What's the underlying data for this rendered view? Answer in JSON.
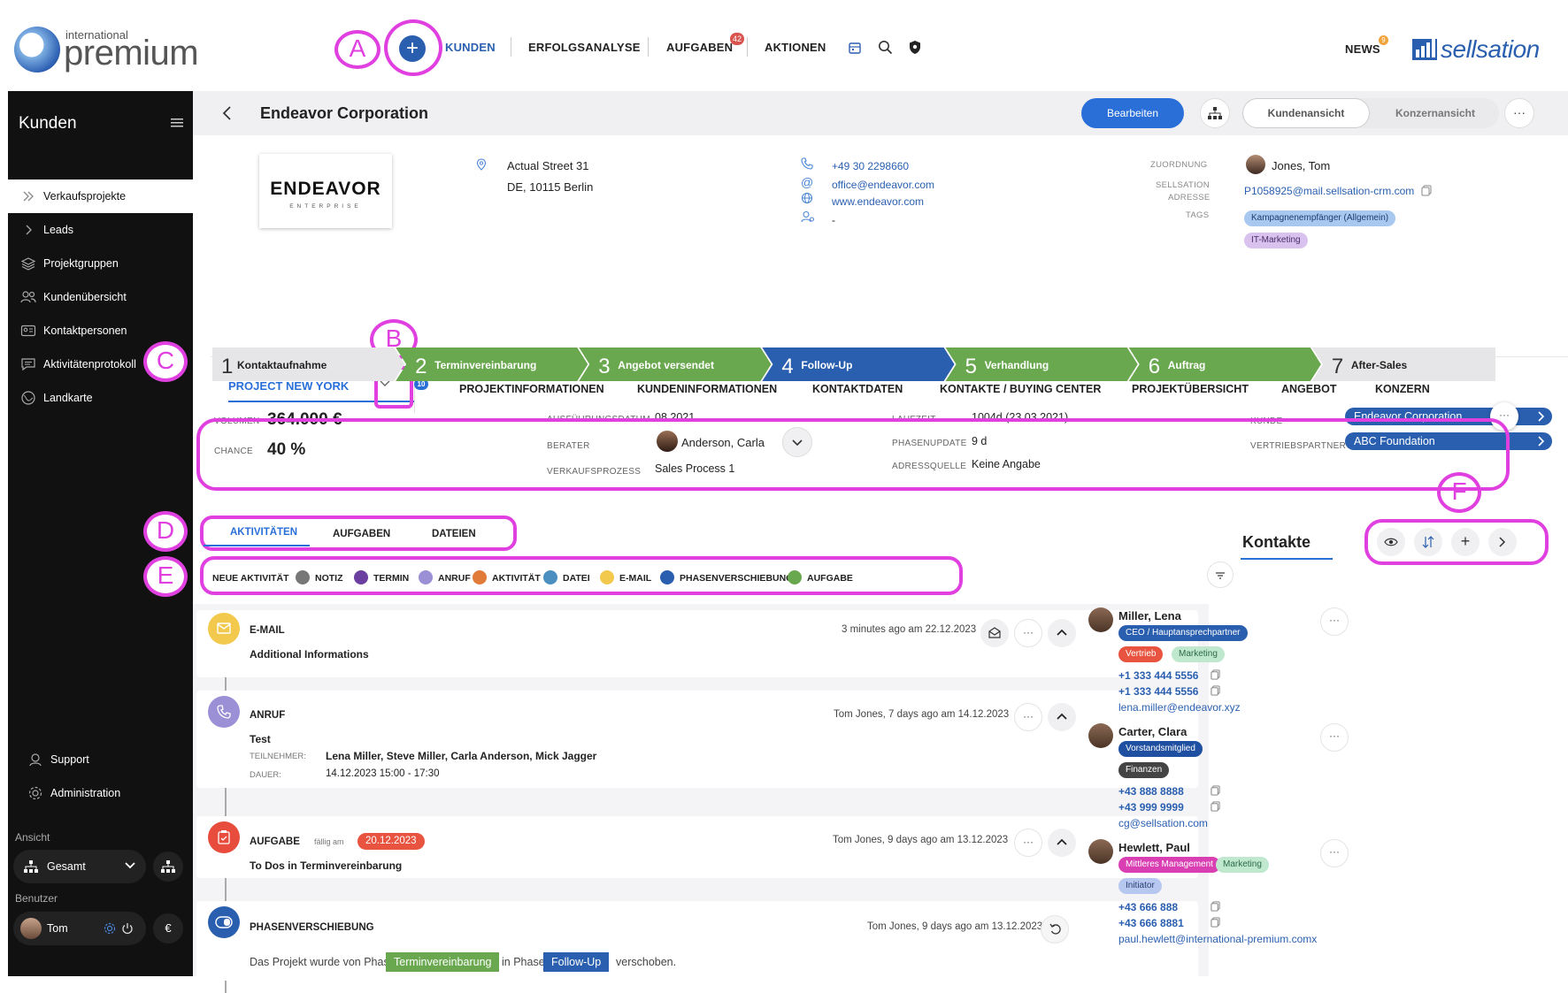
{
  "brand": {
    "small": "international",
    "big": "premium",
    "partner": "sellsation"
  },
  "nav": {
    "items": [
      "KUNDEN",
      "ERFOLGSANALYSE",
      "AUFGABEN",
      "AKTIONEN"
    ],
    "aufgaben_badge": "42",
    "news": "NEWS",
    "news_badge": "9"
  },
  "callouts": [
    "A",
    "B",
    "C",
    "D",
    "E",
    "F"
  ],
  "sidebar": {
    "title": "Kunden",
    "items": [
      "Verkaufsprojekte",
      "Leads",
      "Projektgruppen",
      "Kundenübersicht",
      "Kontaktpersonen",
      "Aktivitätenprotokoll",
      "Landkarte"
    ],
    "support": "Support",
    "admin": "Administration",
    "ansicht_label": "Ansicht",
    "ansicht_value": "Gesamt",
    "benutzer_label": "Benutzer",
    "user": "Tom",
    "currency": "€"
  },
  "header": {
    "title": "Endeavor Corporation",
    "edit": "Bearbeiten",
    "view1": "Kundenansicht",
    "view2": "Konzernansicht",
    "more": "···"
  },
  "company": {
    "logo_text": "ENDEAVOR",
    "logo_sub": "ENTERPRISE",
    "street": "Actual Street 31",
    "city": "DE, 10115 Berlin",
    "phone": "+49 30 2298660",
    "email": "office@endeavor.com",
    "web": "www.endeavor.com",
    "dash": "-",
    "zuordnung_label": "ZUORDNUNG",
    "zuordnung": "Jones, Tom",
    "sellsation_label1": "SELLSATION",
    "sellsation_label2": "ADRESSE",
    "sellsation_email": "P1058925@mail.sellsation-crm.com",
    "tags_label": "TAGS",
    "tags": [
      "Kampagnenempfänger (Allgemein)",
      "IT-Marketing"
    ]
  },
  "tabs": {
    "project": "PROJECT NEW YORK",
    "project_badge": "10",
    "items": [
      "PROJEKTINFORMATIONEN",
      "KUNDENINFORMATIONEN",
      "KONTAKTDATEN",
      "KONTAKTE / BUYING CENTER",
      "PROJEKTÜBERSICHT",
      "ANGEBOT",
      "KONZERN"
    ]
  },
  "stages": [
    {
      "n": "1",
      "name": "Kontaktaufnahme",
      "color": "#e6e6e8"
    },
    {
      "n": "2",
      "name": "Terminvereinbarung",
      "color": "#6aa84f"
    },
    {
      "n": "3",
      "name": "Angebot versendet",
      "color": "#6aa84f"
    },
    {
      "n": "4",
      "name": "Follow-Up",
      "color": "#2a5fb0"
    },
    {
      "n": "5",
      "name": "Verhandlung",
      "color": "#6aa84f"
    },
    {
      "n": "6",
      "name": "Auftrag",
      "color": "#6aa84f"
    },
    {
      "n": "7",
      "name": "After-Sales",
      "color": "#e6e6e8"
    }
  ],
  "info": {
    "volumen_label": "VOLUMEN",
    "volumen": "364.000 €",
    "chance_label": "CHANCE",
    "chance": "40 %",
    "ausf_label": "AUSFÜHRUNGSDATUM",
    "ausf": "08.2021",
    "berater_label": "BERATER",
    "berater": "Anderson, Carla",
    "vp_label": "VERKAUFSPROZESS",
    "vp": "Sales Process 1",
    "laufzeit_label": "LAUFZEIT",
    "laufzeit": "1004d (23.03.2021)",
    "phase_label": "PHASENUPDATE",
    "phase": "9 d",
    "quelle_label": "ADRESSQUELLE",
    "quelle": "Keine Angabe",
    "kunde_label": "KUNDE",
    "kunde": "Endeavor Corporation",
    "vp2_label": "VERTRIEBSPARTNER",
    "vp2": "ABC Foundation"
  },
  "subtabs": [
    "AKTIVITÄTEN",
    "AUFGABEN",
    "DATEIEN"
  ],
  "filters": [
    {
      "label": "NEUE AKTIVITÄT",
      "color": ""
    },
    {
      "label": "NOTIZ",
      "color": "#777"
    },
    {
      "label": "TERMIN",
      "color": "#6b3fa0"
    },
    {
      "label": "ANRUF",
      "color": "#9b8fd6"
    },
    {
      "label": "AKTIVITÄT",
      "color": "#e07b39"
    },
    {
      "label": "DATEI",
      "color": "#4a8fc0"
    },
    {
      "label": "E-MAIL",
      "color": "#f2c94c"
    },
    {
      "label": "PHASENVERSCHIEBUNG",
      "color": "#2a5fb0"
    },
    {
      "label": "AUFGABE",
      "color": "#6aa84f"
    }
  ],
  "activities": {
    "email": {
      "type": "E-MAIL",
      "title": "Additional Informations",
      "time": "3 minutes ago am 22.12.2023"
    },
    "call": {
      "type": "ANRUF",
      "title": "Test",
      "time": "Tom Jones, 7 days ago am 14.12.2023",
      "teil_label": "TEILNEHMER:",
      "teil": "Lena Miller, Steve Miller, Carla Anderson, Mick Jagger",
      "dauer_label": "DAUER:",
      "dauer": "14.12.2023 15:00 - 17:30"
    },
    "task": {
      "type": "AUFGABE",
      "due_label": "fällig am",
      "due": "20.12.2023",
      "title": "To Dos in Terminvereinbarung",
      "time": "Tom Jones, 9 days ago am 13.12.2023"
    },
    "phase": {
      "type": "PHASENVERSCHIEBUNG",
      "time": "Tom Jones, 9 days ago am 13.12.2023",
      "t1": "Das Projekt wurde von Phase",
      "from": "Terminvereinbarung",
      "t2": "in Phase",
      "to": "Follow-Up",
      "t3": "verschoben."
    }
  },
  "contacts": {
    "title": "Kontakte",
    "list": [
      {
        "name": "Miller, Lena",
        "role": "CEO / Hauptansprechpartner",
        "tags": [
          "Vertrieb",
          "Marketing"
        ],
        "phones": [
          "+1 333 444 5556",
          "+1 333 444 5556"
        ],
        "email": "lena.miller@endeavor.xyz"
      },
      {
        "name": "Carter, Clara",
        "role": "Vorstandsmitglied",
        "tags": [
          "Finanzen"
        ],
        "phones": [
          "+43 888 8888",
          "+43 999 9999"
        ],
        "email": "cg@sellsation.com"
      },
      {
        "name": "Hewlett, Paul",
        "role": "Mittleres Management",
        "tags": [
          "Marketing",
          "Initiator"
        ],
        "phones": [
          "+43 666 888",
          "+43 666 8881"
        ],
        "email": "paul.hewlett@international-premium.comx"
      }
    ]
  }
}
